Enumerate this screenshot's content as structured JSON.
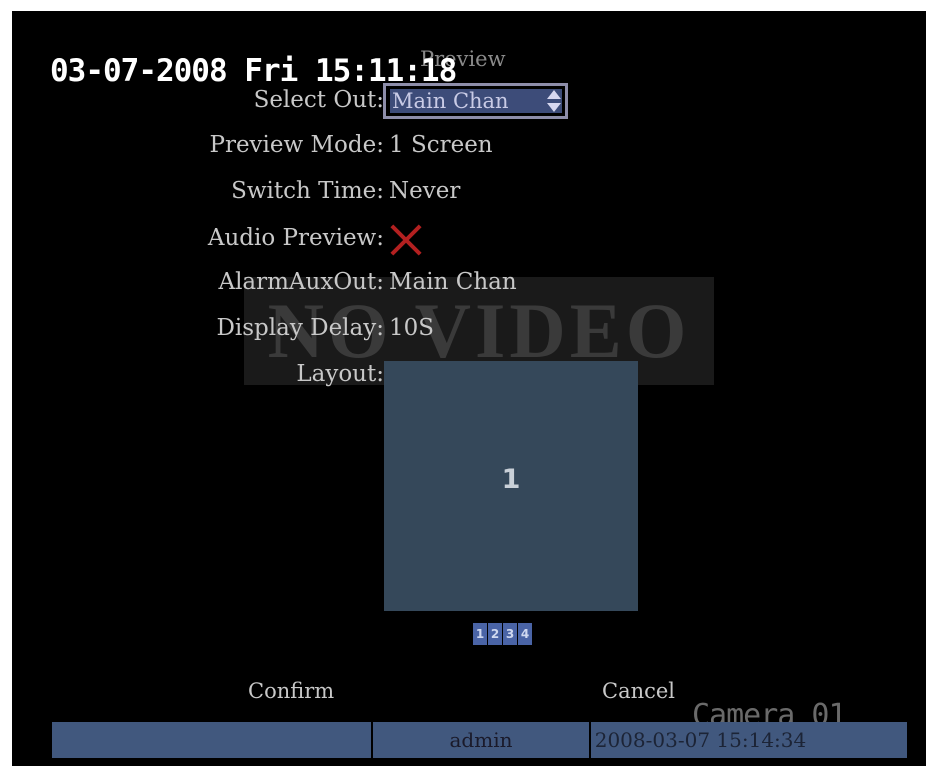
{
  "screen": {
    "title": "Preview",
    "clock": "03-07-2008 Fri 15:11:18",
    "watermark": "NO VIDEO",
    "camera": "Camera 01"
  },
  "settings": {
    "select_out": {
      "label": "Select Out:",
      "value": "Main Chan"
    },
    "preview_mode": {
      "label": "Preview Mode:",
      "value": "1 Screen"
    },
    "switch_time": {
      "label": "Switch Time:",
      "value": "Never"
    },
    "audio_preview": {
      "label": "Audio Preview:",
      "value": "off",
      "icon": "x-icon"
    },
    "alarm_aux_out": {
      "label": "AlarmAuxOut:",
      "value": "Main Chan"
    },
    "display_delay": {
      "label": "Display Delay:",
      "value": "10S"
    },
    "layout": {
      "label": "Layout:",
      "window_number": "1",
      "pages": [
        "1",
        "2",
        "3",
        "4"
      ]
    }
  },
  "buttons": {
    "confirm": "Confirm",
    "cancel": "Cancel"
  },
  "status_bar": {
    "user": "admin",
    "datetime": "2008-03-07 15:14:34"
  },
  "colors": {
    "select_box": "#3d4c79",
    "layout_bg": "#35485a",
    "status_bg": "#41587e",
    "x_mark": "#b32020"
  }
}
